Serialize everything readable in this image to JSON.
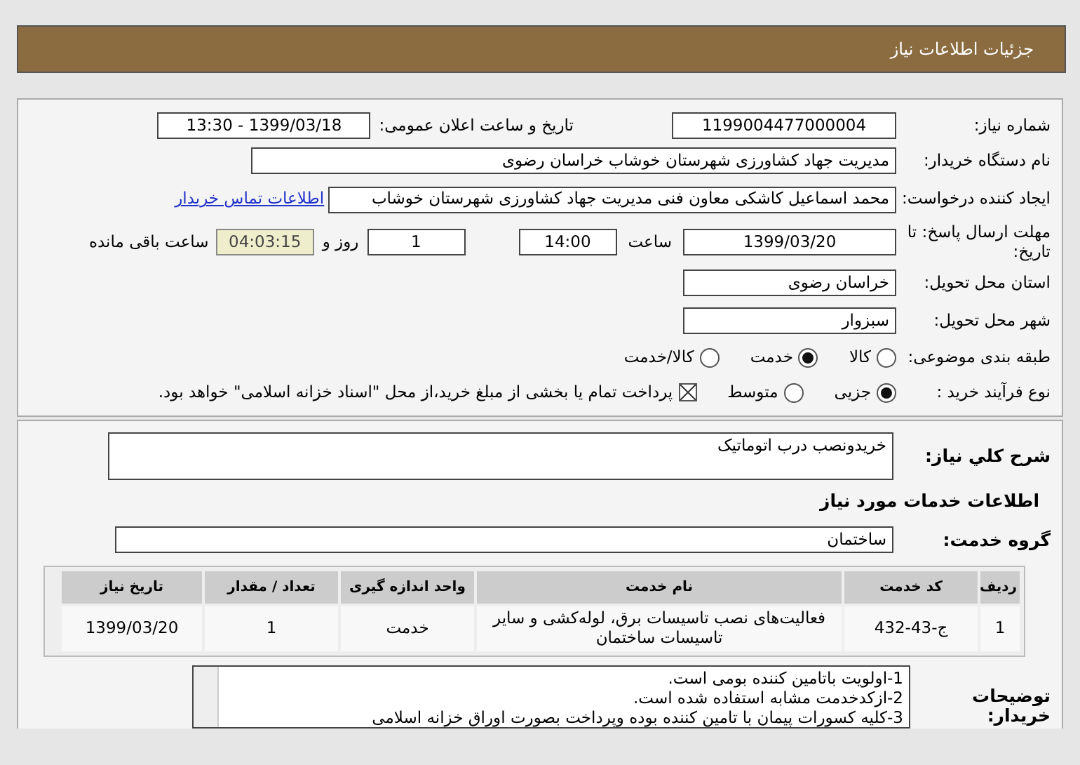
{
  "header": {
    "title": "جزئیات اطلاعات نیاز"
  },
  "need_number": {
    "label": "شماره نیاز:",
    "value": "1199004477000004"
  },
  "announce": {
    "label": "تاریخ و ساعت اعلان عمومی:",
    "value": "1399/03/18 - 13:30"
  },
  "buyer_org": {
    "label": "نام دستگاه خریدار:",
    "value": "مدیریت جهاد کشاورزی شهرستان خوشاب خراسان رضوی"
  },
  "requester": {
    "label": "ایجاد کننده درخواست:",
    "value": "محمد اسماعیل کاشکی معاون فنی مدیریت جهاد کشاورزی شهرستان خوشاب",
    "link": "اطلاعات تماس خریدار"
  },
  "deadline": {
    "label": "مهلت ارسال پاسخ: تا تاریخ:",
    "date": "1399/03/20",
    "time_label": "ساعت",
    "time": "14:00",
    "days": "1",
    "days_label": "روز و",
    "remaining": "04:03:15",
    "remaining_label": "ساعت باقی مانده"
  },
  "province": {
    "label": "استان محل تحویل:",
    "value": "خراسان رضوی"
  },
  "city": {
    "label": "شهر محل تحویل:",
    "value": "سبزوار"
  },
  "category": {
    "label": "طبقه بندی موضوعی:",
    "options": [
      {
        "label": "کالا",
        "selected": false
      },
      {
        "label": "خدمت",
        "selected": true
      },
      {
        "label": "کالا/خدمت",
        "selected": false
      }
    ]
  },
  "process": {
    "label": "نوع فرآیند خرید :",
    "options": [
      {
        "label": "جزیی",
        "selected": true
      },
      {
        "label": "متوسط",
        "selected": false
      }
    ],
    "payment": {
      "label": "پرداخت تمام یا بخشی از مبلغ خرید،از محل \"اسناد خزانه اسلامی\" خواهد بود.",
      "checked": true
    }
  },
  "summary": {
    "label": "شرح کلي نياز:",
    "value": "خریدونصب درب اتوماتیک"
  },
  "services_title": "اطلاعات خدمات مورد نیاز",
  "service_group": {
    "label": "گروه خدمت:",
    "value": "ساختمان"
  },
  "table": {
    "columns": [
      "ردیف",
      "کد خدمت",
      "نام خدمت",
      "واحد اندازه گیری",
      "تعداد / مقدار",
      "تاریخ نیاز"
    ],
    "rows": [
      [
        "1",
        "ج-43-432",
        "فعالیت‌های نصب تاسیسات برق، لوله‌کشی و سایر تاسیسات ساختمان",
        "خدمت",
        "1",
        "1399/03/20"
      ]
    ]
  },
  "buyer_notes": {
    "label": "توضیحات خریدار:",
    "lines": [
      "1-اولویت باتامین کننده بومی است.",
      "2-ازکدخدمت مشابه استفاده شده است.",
      "3-کلیه کسورات پیمان با تامین کننده بوده وپرداخت بصورت اوراق خزانه اسلامی"
    ]
  }
}
